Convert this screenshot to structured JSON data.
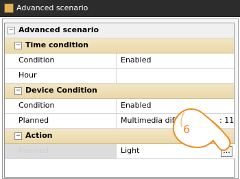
{
  "window": {
    "title": "Advanced scenario"
  },
  "root": {
    "label": "Advanced scenario"
  },
  "sections": [
    {
      "label": "Time condition",
      "rows": [
        {
          "name": "Condition",
          "value": "Enabled"
        },
        {
          "name": "Hour",
          "value": ""
        }
      ]
    },
    {
      "label": "Device Condition",
      "rows": [
        {
          "name": "Condition",
          "value": "Enabled"
        },
        {
          "name": "Planned",
          "value": "Multimedia diffusion",
          "suffix": ": 11"
        }
      ]
    },
    {
      "label": "Action",
      "rows": [
        {
          "name": "Planned",
          "value": "Light",
          "button": "..."
        }
      ]
    }
  ],
  "annotation": {
    "step": "6"
  },
  "colors": {
    "section_header": "#ecdcb2",
    "titlebar": "#2c2c2c",
    "hand_outline": "#f08a1c"
  }
}
